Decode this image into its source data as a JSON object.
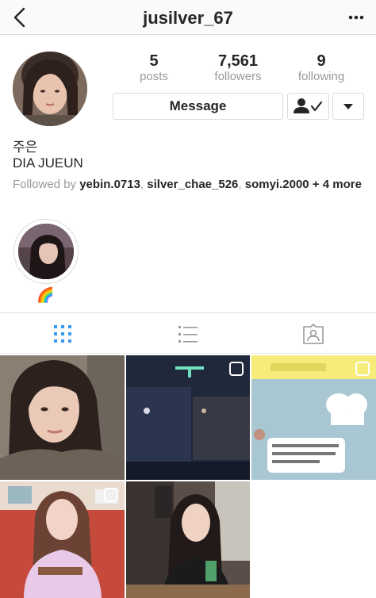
{
  "header": {
    "username": "jusilver_67",
    "back_icon": "chevron-left-icon",
    "more_icon": "more-horizontal-icon"
  },
  "profile": {
    "stats": [
      {
        "number": "5",
        "label": "posts"
      },
      {
        "number": "7,561",
        "label": "followers"
      },
      {
        "number": "9",
        "label": "following"
      }
    ],
    "message_label": "Message",
    "name_korean": "주은",
    "name": "DIA JUEUN",
    "followed_by_prefix": "Followed by ",
    "followed_by_users": [
      "yebin.0713",
      "silver_chae_526",
      "somyi.2000"
    ],
    "followed_by_more": "+ 4 more"
  },
  "highlights": [
    {
      "label": "🌈"
    }
  ],
  "tabs": [
    {
      "name": "grid",
      "icon": "grid-icon",
      "active": true
    },
    {
      "name": "list",
      "icon": "list-icon",
      "active": false
    },
    {
      "name": "tagged",
      "icon": "tagged-person-icon",
      "active": false
    }
  ],
  "colors": {
    "accent": "#3897f0",
    "border": "#dbdbdb",
    "muted": "#999999",
    "text": "#262626"
  }
}
